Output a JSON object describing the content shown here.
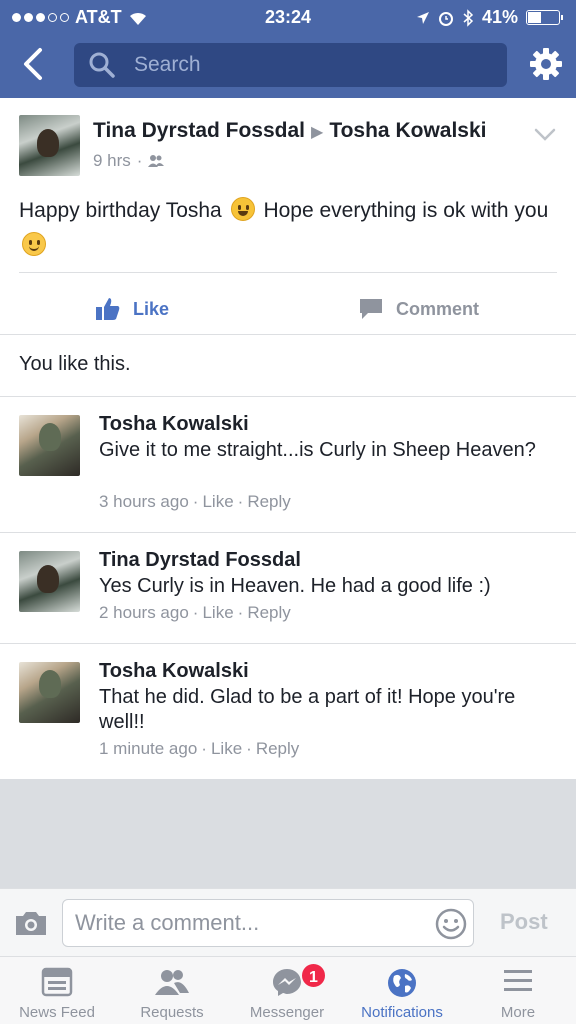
{
  "status_bar": {
    "carrier": "AT&T",
    "time": "23:24",
    "battery": "41%",
    "battery_level": 0.41
  },
  "header": {
    "search_placeholder": "Search"
  },
  "post": {
    "author": "Tina Dyrstad Fossdal",
    "target": "Tosha Kowalski",
    "time": "9 hrs",
    "text_part1": "Happy birthday Tosha",
    "text_part2": "Hope everything is ok with you",
    "like_label": "Like",
    "comment_label": "Comment",
    "likes_summary": "You like this."
  },
  "comments": [
    {
      "author": "Tosha Kowalski",
      "text": "Give it to me straight...is Curly in Sheep Heaven?",
      "time": "3 hours ago",
      "like_label": "Like",
      "reply_label": "Reply"
    },
    {
      "author": "Tina Dyrstad Fossdal",
      "text": "Yes Curly is in Heaven. He had a good life :)",
      "time": "2 hours ago",
      "like_label": "Like",
      "reply_label": "Reply"
    },
    {
      "author": "Tosha Kowalski",
      "text": "That he did. Glad to be a part of it! Hope you're well!!",
      "time": "1 minute ago",
      "like_label": "Like",
      "reply_label": "Reply"
    }
  ],
  "composer": {
    "placeholder": "Write a comment...",
    "post_label": "Post"
  },
  "tabbar": {
    "tabs": [
      {
        "label": "News Feed",
        "icon": "news-feed-icon"
      },
      {
        "label": "Requests",
        "icon": "requests-icon"
      },
      {
        "label": "Messenger",
        "icon": "messenger-icon",
        "badge": "1"
      },
      {
        "label": "Notifications",
        "icon": "globe-icon",
        "active": true
      },
      {
        "label": "More",
        "icon": "menu-icon"
      }
    ]
  },
  "colors": {
    "header": "#4a67a8",
    "search_field": "#2f4883",
    "accent": "#4b73c4",
    "badge": "#f02849"
  }
}
